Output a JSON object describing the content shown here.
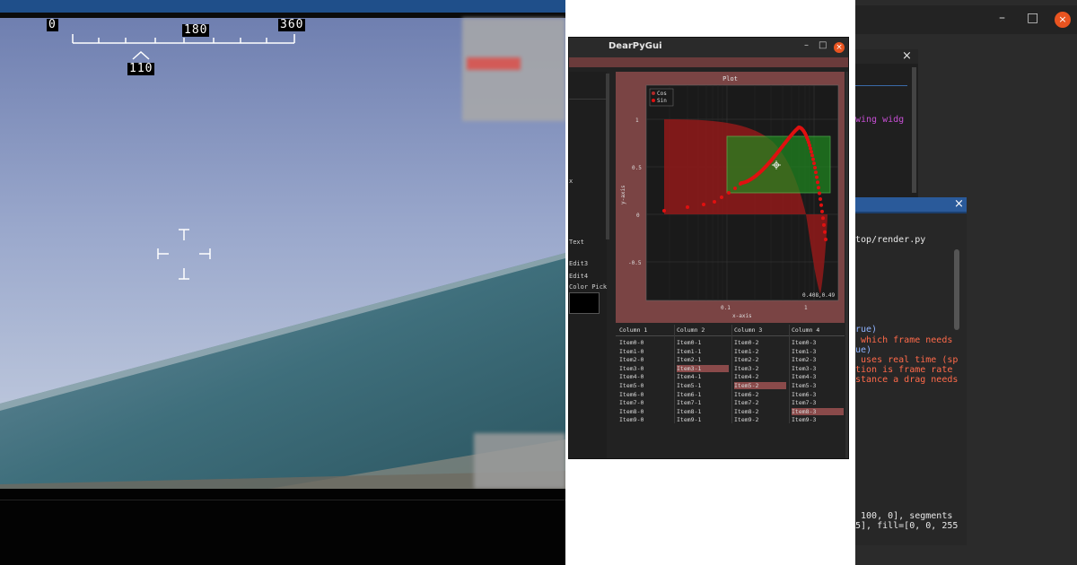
{
  "video": {
    "heading_scale": {
      "left": "0",
      "center": "180",
      "right": "360"
    },
    "heading_value": "110"
  },
  "dearpygui": {
    "window_title": "DearPyGui",
    "controls": {
      "minimize": "–",
      "maximize": "□",
      "close": "×"
    },
    "left_labels": [
      "x",
      "Text",
      "Edit3",
      "Edit4",
      "Color Pick"
    ],
    "plot": {
      "title": "Plot",
      "x_label": "x-axis",
      "y_label": "y-axis",
      "x_ticks": [
        "0.1",
        "1"
      ],
      "y_ticks": [
        "1",
        "0.5",
        "0",
        "-0.5"
      ],
      "legend": [
        "Cos",
        "Sin"
      ],
      "cursor_readout": "0.408,0.49",
      "colors": {
        "frame": "#7a4444",
        "plot_bg": "#1a1a1a",
        "cos_fill": "#8b1a1a",
        "sin_line": "#e01010",
        "rect_fill": "#1f8a1f",
        "rect_edge": "#5bd65b"
      }
    },
    "table": {
      "headers": [
        "Column 1",
        "Column 2",
        "Column 3",
        "Column 4"
      ],
      "rows": [
        [
          "Item0-0",
          "Item0-1",
          "Item0-2",
          "Item0-3"
        ],
        [
          "Item1-0",
          "Item1-1",
          "Item1-2",
          "Item1-3"
        ],
        [
          "Item2-0",
          "Item2-1",
          "Item2-2",
          "Item2-3"
        ],
        [
          "Item3-0",
          "Item3-1",
          "Item3-2",
          "Item3-3"
        ],
        [
          "Item4-0",
          "Item4-1",
          "Item4-2",
          "Item4-3"
        ],
        [
          "Item5-0",
          "Item5-1",
          "Item5-2",
          "Item5-3"
        ],
        [
          "Item6-0",
          "Item6-1",
          "Item6-2",
          "Item6-3"
        ],
        [
          "Item7-0",
          "Item7-1",
          "Item7-2",
          "Item7-3"
        ],
        [
          "Item8-0",
          "Item8-1",
          "Item8-2",
          "Item8-3"
        ],
        [
          "Item9-0",
          "Item9-1",
          "Item9-2",
          "Item9-3"
        ]
      ],
      "selected": [
        "Item3-1",
        "Item5-2",
        "Item8-3"
      ]
    }
  },
  "editor": {
    "window_controls": {
      "minimize": "–",
      "maximize": "□",
      "close": "×"
    },
    "panel_close": "×",
    "inner_close": "×",
    "lines": {
      "widget": "wing widg",
      "path": "top/render.py",
      "l1": "rue)",
      "l2": " which frame needs",
      "l3": "ue)",
      "l4": " uses real time (sp",
      "l5": "tion is frame rate",
      "l6": "stance a drag needs",
      "l7": " 100, 0], segments",
      "l8": "5], fill=[0, 0, 255"
    }
  }
}
